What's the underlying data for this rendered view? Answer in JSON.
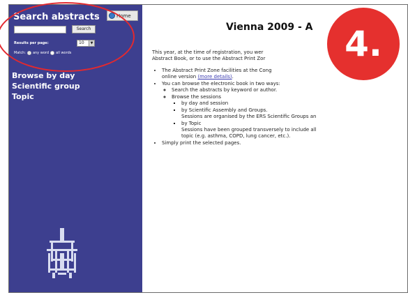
{
  "sidebar": {
    "search_title": "Search abstracts",
    "home_label": "Home",
    "search_button": "Search",
    "search_value": "",
    "results_label": "Results per page:",
    "results_value": "10",
    "match_label": "Match:",
    "match_any": "any word",
    "match_all": "all words",
    "nav": [
      "Browse by day",
      "Scientific group",
      "Topic"
    ]
  },
  "main": {
    "title": "Vienna 2009 - A",
    "intro": "This year, at the time of registration, you wer",
    "intro2": "Abstract Book, or to use the Abstract Print Zor",
    "bullet1_a": "The Abstract Print Zone facilities at the Cong",
    "bullet1_b": "online version",
    "more_details": "(more details)",
    "bullet2": "You can browse the electronic book in two ways:",
    "sub1": "Search the abstracts by keyword or author.",
    "sub2": "Browse the sessions",
    "sub2_1": "by day and session",
    "sub2_2": "by Scientific Assembly and Groups.",
    "sub2_2b": "Sessions are organised by the ERS Scientific Groups an",
    "sub2_3": "by Topic",
    "sub2_3b": "Sessions have been grouped transversely to include all",
    "sub2_3c": "topic (e.g. asthma, COPD, lung cancer, etc.).",
    "bullet3": "Simply print the selected pages."
  },
  "overlay": {
    "badge": "4."
  },
  "colors": {
    "sidebar_bg": "#3d3f8f",
    "badge": "#e5302e",
    "circle": "#e2292f"
  }
}
